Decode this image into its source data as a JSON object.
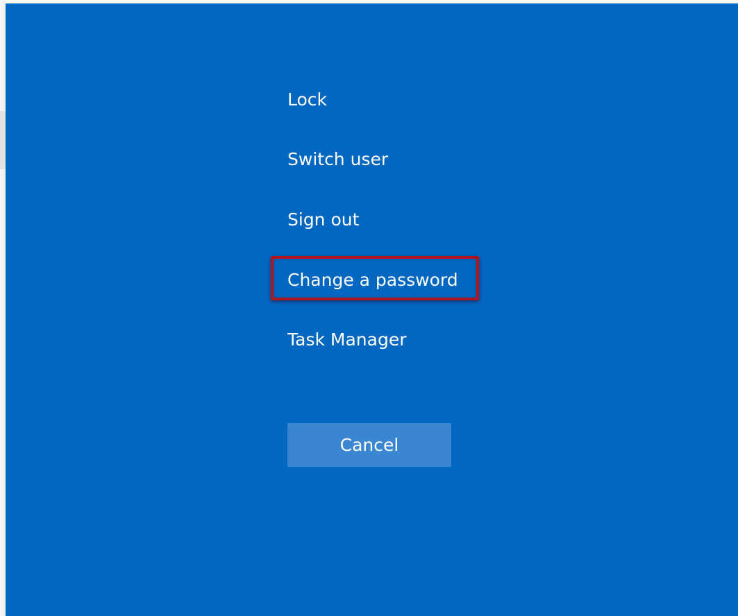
{
  "security_options": {
    "items": [
      {
        "label": "Lock"
      },
      {
        "label": "Switch user"
      },
      {
        "label": "Sign out"
      },
      {
        "label": "Change a password"
      },
      {
        "label": "Task Manager"
      }
    ],
    "cancel_label": "Cancel"
  },
  "colors": {
    "background": "#0167c0",
    "text": "#ffffff",
    "cancel_button": "#3a86d0",
    "highlight_border": "#b0151f"
  }
}
